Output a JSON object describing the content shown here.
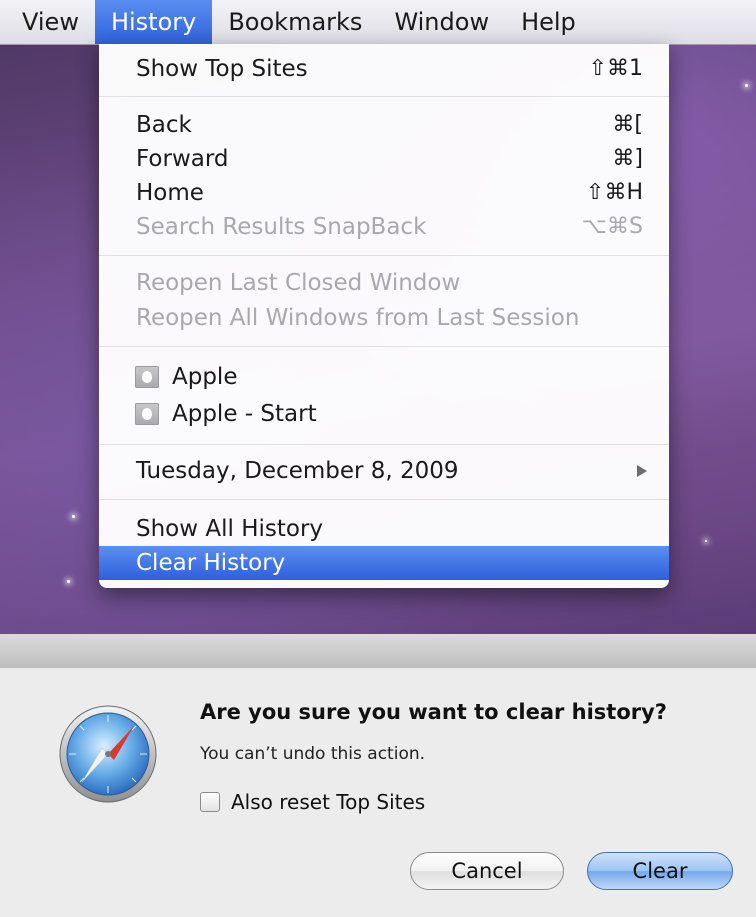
{
  "menubar": {
    "items": [
      "View",
      "History",
      "Bookmarks",
      "Window",
      "Help"
    ],
    "active_index": 1
  },
  "history_menu": {
    "show_top_sites": {
      "label": "Show Top Sites",
      "shortcut": "⇧⌘1"
    },
    "back": {
      "label": "Back",
      "shortcut": "⌘["
    },
    "forward": {
      "label": "Forward",
      "shortcut": "⌘]"
    },
    "home": {
      "label": "Home",
      "shortcut": "⇧⌘H"
    },
    "snapback": {
      "label": "Search Results SnapBack",
      "shortcut": "⌥⌘S"
    },
    "reopen_last_window": {
      "label": "Reopen Last Closed Window"
    },
    "reopen_all_windows": {
      "label": "Reopen All Windows from Last Session"
    },
    "recent_sites": [
      {
        "label": "Apple",
        "icon": "apple-site-icon"
      },
      {
        "label": "Apple - Start",
        "icon": "apple-site-icon"
      }
    ],
    "date_submenu": {
      "label": "Tuesday, December 8, 2009"
    },
    "show_all_history": {
      "label": "Show All History"
    },
    "clear_history": {
      "label": "Clear History"
    }
  },
  "dialog": {
    "icon": "safari-compass-icon",
    "title": "Are you sure you want to clear history?",
    "message": "You can’t undo this action.",
    "checkbox_label": "Also reset Top Sites",
    "checkbox_checked": false,
    "cancel_label": "Cancel",
    "clear_label": "Clear"
  },
  "colors": {
    "selection_blue": "#3a6ee4",
    "disabled_text": "#a8a8ae",
    "default_button": "#8fbcf0"
  }
}
